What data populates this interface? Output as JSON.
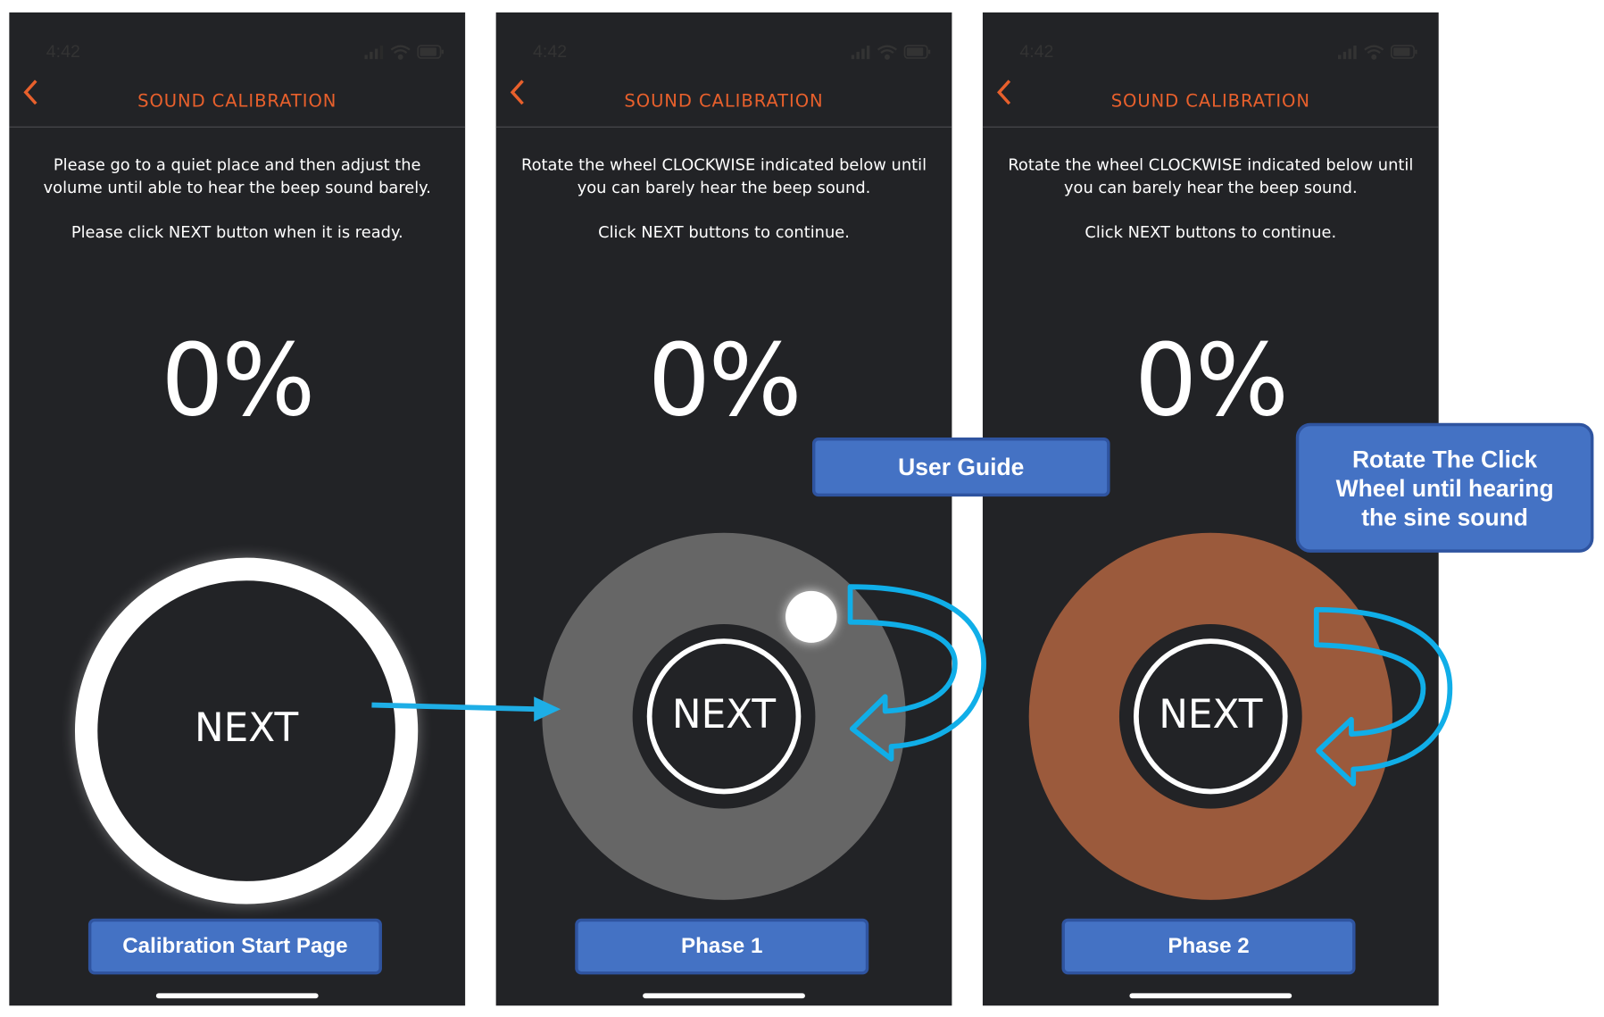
{
  "accent_color": "#e8602c",
  "label_color": "#4472c4",
  "status_bar": {
    "time": "4:42"
  },
  "screens": [
    {
      "title": "SOUND CALIBRATION",
      "instruction_1": "Please go to a quiet place and then adjust the volume until able to hear the beep sound barely.",
      "instruction_2": "Please click NEXT button when it is ready.",
      "percent": "0%",
      "next_label": "NEXT",
      "caption": "Calibration Start Page"
    },
    {
      "title": "SOUND CALIBRATION",
      "instruction_1": "Rotate the wheel CLOCKWISE indicated below until you can barely hear the beep sound.",
      "instruction_2": "Click NEXT buttons to continue.",
      "percent": "0%",
      "next_label": "NEXT",
      "caption": "Phase 1",
      "wheel_color": "#666666"
    },
    {
      "title": "SOUND CALIBRATION",
      "instruction_1": "Rotate the wheel CLOCKWISE indicated below until you can barely hear the beep sound.",
      "instruction_2": "Click NEXT buttons to continue.",
      "percent": "0%",
      "next_label": "NEXT",
      "caption": "Phase 2",
      "wheel_color": "#9b5a3c"
    }
  ],
  "callouts": {
    "user_guide": "User Guide",
    "rotate_hint": "Rotate The Click Wheel until hearing the sine sound"
  },
  "icons": [
    "back-chevron-icon",
    "signal-icon",
    "wifi-icon",
    "battery-icon",
    "clockwise-arrow-icon",
    "flow-arrow-icon"
  ]
}
